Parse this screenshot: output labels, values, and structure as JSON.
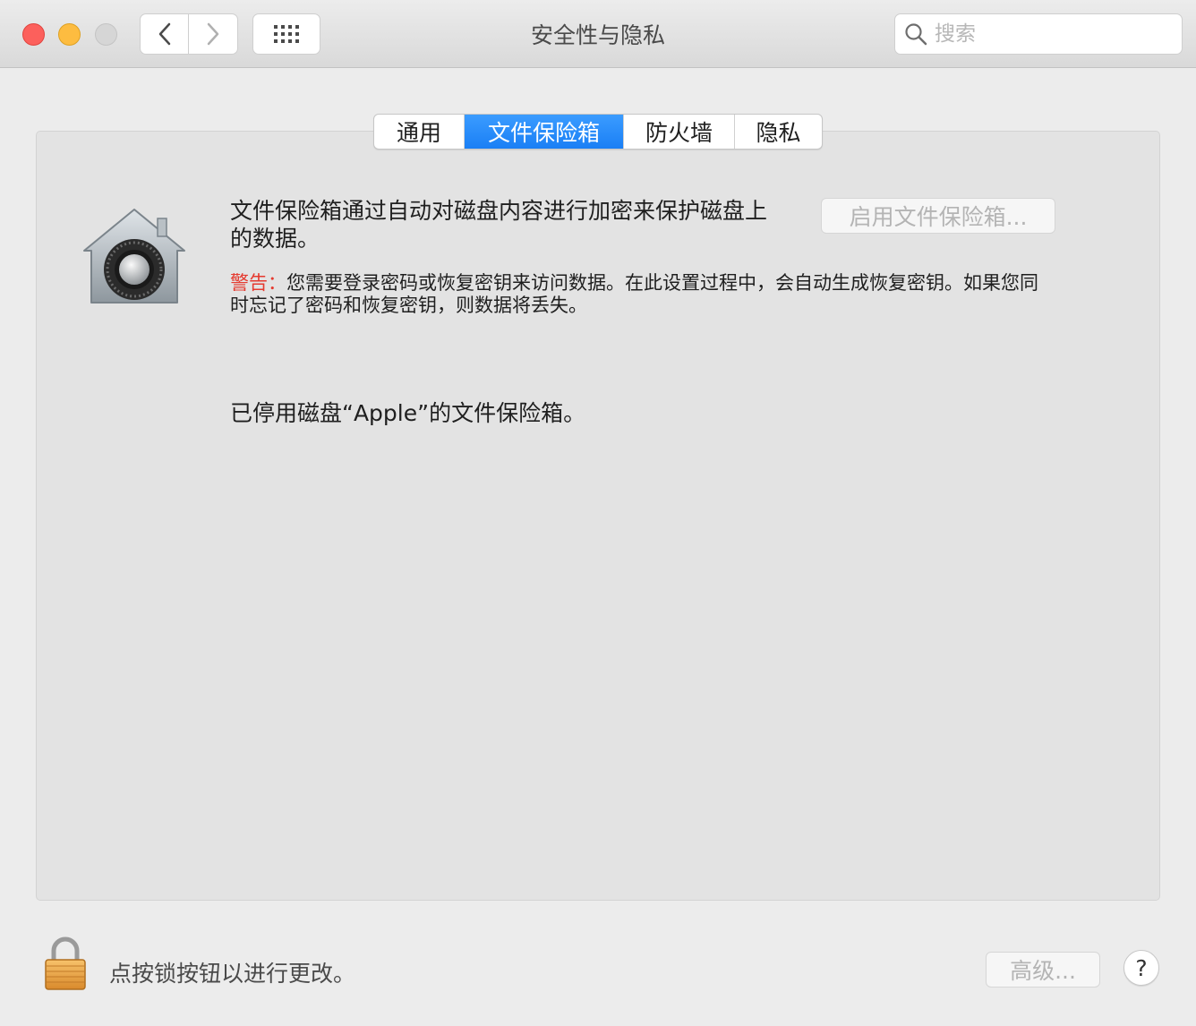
{
  "window": {
    "title": "安全性与隐私"
  },
  "search": {
    "placeholder": "搜索"
  },
  "tabs": [
    {
      "label": "通用",
      "active": false
    },
    {
      "label": "文件保险箱",
      "active": true
    },
    {
      "label": "防火墙",
      "active": false
    },
    {
      "label": "隐私",
      "active": false
    }
  ],
  "filevault": {
    "description": "文件保险箱通过自动对磁盘内容进行加密来保护磁盘上的数据。",
    "enable_button": "启用文件保险箱...",
    "warning_label": "警告：",
    "warning_text": "您需要登录密码或恢复密钥来访问数据。在此设置过程中，会自动生成恢复密钥。如果您同时忘记了密码和恢复密钥，则数据将丢失。",
    "status": "已停用磁盘“Apple”的文件保险箱。"
  },
  "footer": {
    "lock_text": "点按锁按钮以进行更改。",
    "advanced_button": "高级...",
    "help_button": "?"
  },
  "colors": {
    "accent": "#1a7ff5",
    "warning": "#e53a2f",
    "close": "#fc605c",
    "minimize": "#fdbc40"
  }
}
